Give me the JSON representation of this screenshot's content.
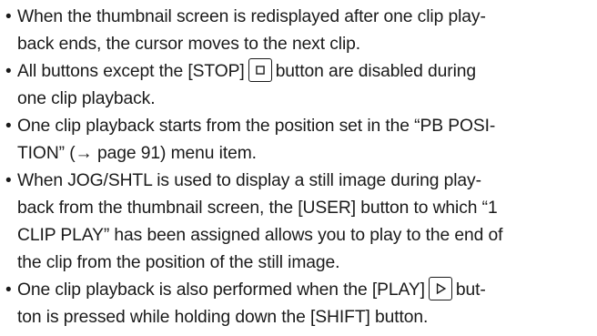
{
  "bullets": [
    {
      "lines": [
        "When the thumbnail screen is redisplayed after one clip play-",
        "back ends, the cursor moves to the next clip."
      ]
    },
    {
      "line1_before": "All buttons except the [STOP]",
      "icon": "stop-icon",
      "line1_after": "button are disabled during",
      "line2": "one clip playback."
    },
    {
      "lines": [
        "One clip playback starts from the position set in the “PB POSI-",
        "TION” (→ page 91) menu item."
      ]
    },
    {
      "lines": [
        "When JOG/SHTL is used to display a still image during play-",
        "back from the thumbnail screen, the [USER] button to which “1",
        "CLIP PLAY” has been assigned allows you to play to the end of",
        "the clip from the position of the still image."
      ]
    },
    {
      "line1_before": "One clip playback is also performed when the [PLAY]",
      "icon": "play-icon",
      "line1_after": "but-",
      "line2": "ton is pressed while holding down the [SHIFT] button."
    }
  ],
  "bullet_symbol": "•"
}
